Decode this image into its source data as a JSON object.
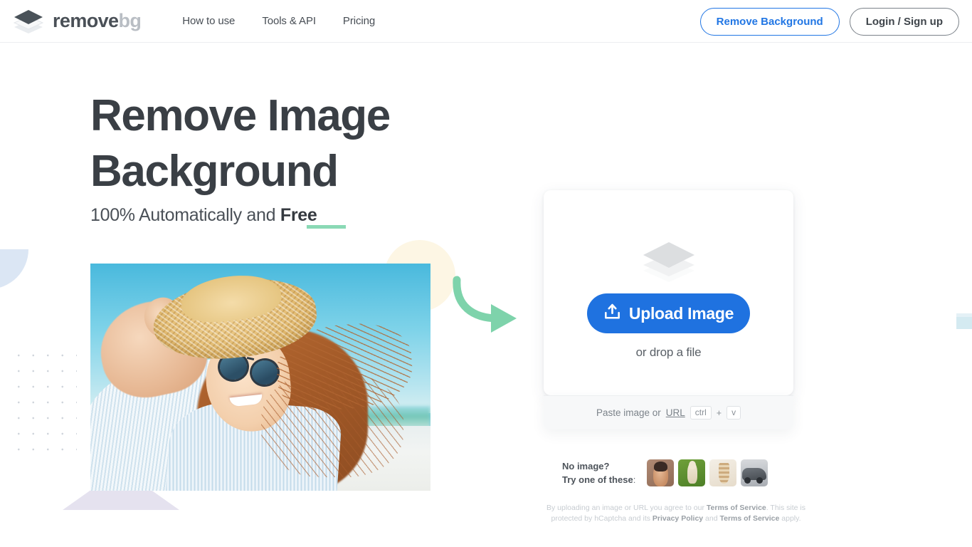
{
  "brand": {
    "name_dark": "remove",
    "name_light": "bg",
    "logo_icon": "stacked-layers-icon"
  },
  "nav": {
    "items": [
      {
        "label": "How to use"
      },
      {
        "label": "Tools & API"
      },
      {
        "label": "Pricing"
      }
    ]
  },
  "header_actions": {
    "remove_background_label": "Remove Background",
    "login_signup_label": "Login / Sign up",
    "accent_blue": "#2176e4",
    "outline_gray": "#7b8289"
  },
  "hero": {
    "title_line1": "Remove Image",
    "title_line2": "Background",
    "subtitle_prefix": "100% Automatically and ",
    "subtitle_highlight": "Free",
    "underline_color": "#8ad9b5",
    "photo_alt": "woman in straw hat and sunglasses at the beach",
    "arrow_icon": "curved-arrow-right-icon",
    "arrow_color": "#7ed3ab"
  },
  "upload_card": {
    "logo_icon": "stacked-layers-icon",
    "upload_icon": "upload-tray-icon",
    "upload_button_label": "Upload Image",
    "upload_button_color": "#1f72e0",
    "drop_text": "or drop a file",
    "paste_prefix": "Paste image or ",
    "paste_url_link": "URL",
    "kbd_ctrl": "ctrl",
    "kbd_plus": "+",
    "kbd_v": "v"
  },
  "samples": {
    "label_line1": "No image?",
    "label_line2": "Try one of these",
    "label_colon": ":",
    "thumbs": [
      {
        "name": "thumb-woman-sunglasses"
      },
      {
        "name": "thumb-alpaca"
      },
      {
        "name": "thumb-dessert"
      },
      {
        "name": "thumb-car"
      }
    ]
  },
  "legal": {
    "part1": "By uploading an image or URL you agree to our ",
    "terms1": "Terms of Service",
    "part2": ". This site is protected by hCaptcha and its ",
    "privacy": "Privacy Policy",
    "part3": " and ",
    "terms2": "Terms of Service",
    "part4": " apply."
  }
}
